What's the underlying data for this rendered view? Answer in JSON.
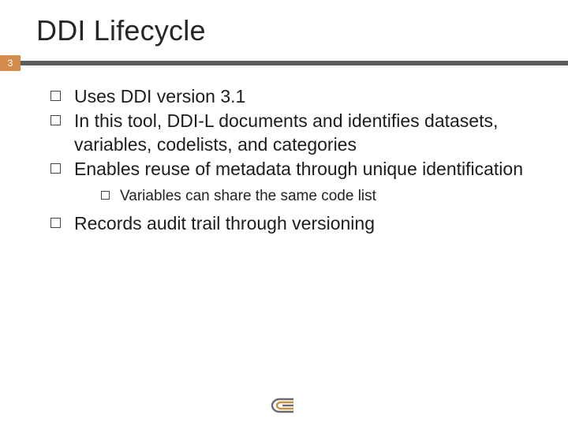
{
  "title": "DDI Lifecycle",
  "page_number": "3",
  "colors": {
    "accent": "#d38b4e",
    "bar": "#5d5d5d"
  },
  "bullets": {
    "b0": "Uses DDI version 3.1",
    "b1": "In this tool, DDI-L documents and identifies datasets, variables, codelists, and categories",
    "b2": "Enables reuse of metadata through unique identification",
    "b2_sub0": "Variables can share the same code list",
    "b3": "Records audit trail through versioning"
  }
}
